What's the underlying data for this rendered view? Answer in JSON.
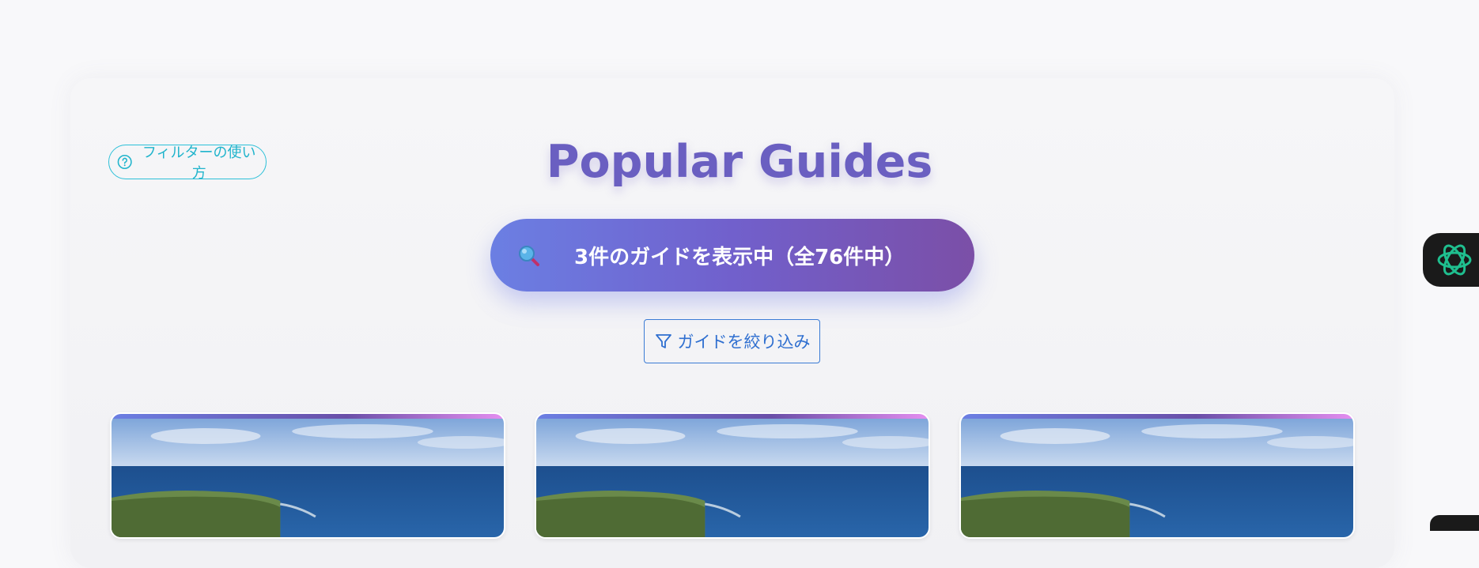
{
  "help": {
    "label": "フィルターの使い方",
    "icon": "question-circle-icon"
  },
  "header": {
    "title": "Popular Guides"
  },
  "results": {
    "summary": "3件のガイドを表示中（全76件中）",
    "icon": "magnifier-icon"
  },
  "filter": {
    "label": "ガイドを絞り込み",
    "icon": "funnel-icon"
  },
  "cards": [
    {
      "image": "coastal-cliff-ocean"
    },
    {
      "image": "coastal-cliff-ocean"
    },
    {
      "image": "coastal-cliff-ocean"
    }
  ],
  "assistant": {
    "icon": "ai-assistant-icon"
  },
  "colors": {
    "title": "#6a5fc1",
    "pill_start": "#6b7fe3",
    "pill_end": "#7b4fa7",
    "help_accent": "#2cc0d8",
    "filter_accent": "#3a7bd5"
  }
}
